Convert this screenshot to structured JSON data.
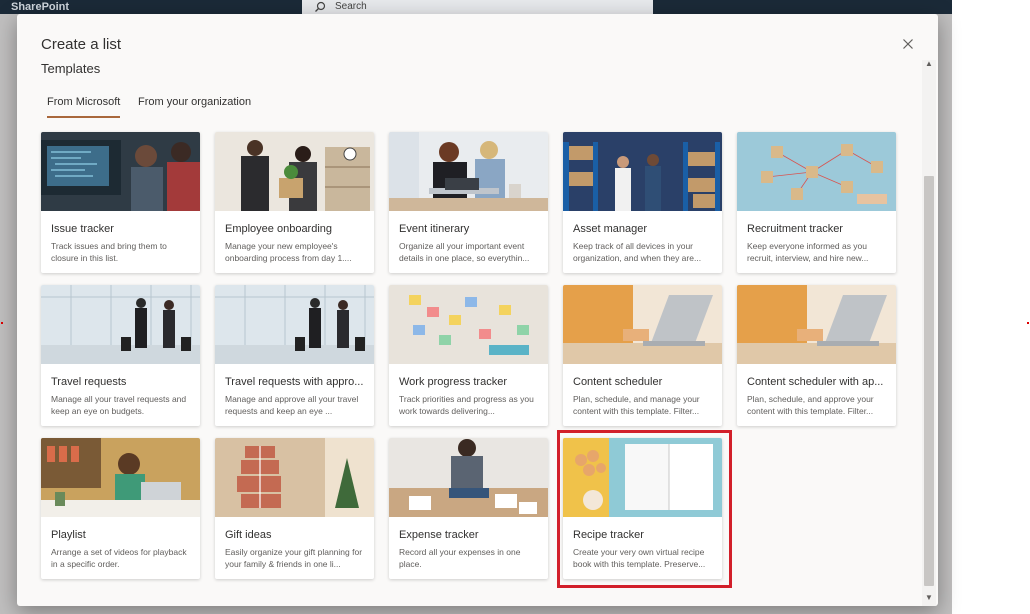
{
  "app": {
    "brand": "SharePoint",
    "search_placeholder": "Search"
  },
  "dialog": {
    "title": "Create a list",
    "section": "Templates",
    "tabs": [
      {
        "label": "From Microsoft",
        "active": true
      },
      {
        "label": "From your organization",
        "active": false
      }
    ]
  },
  "templates": [
    {
      "title": "Issue tracker",
      "description": "Track issues and bring them to closure in this list.",
      "image": "developers-at-monitors"
    },
    {
      "title": "Employee onboarding",
      "description": "Manage your new employee's onboarding process from day 1....",
      "image": "new-employee-handshake"
    },
    {
      "title": "Event itinerary",
      "description": "Organize all your important event details in one place, so everythin...",
      "image": "two-women-at-laptop"
    },
    {
      "title": "Asset manager",
      "description": "Keep track of all devices in your organization, and when they are...",
      "image": "warehouse-workers"
    },
    {
      "title": "Recruitment tracker",
      "description": "Keep everyone informed as you recruit, interview, and hire new...",
      "image": "people-network-cubes"
    },
    {
      "title": "Travel requests",
      "description": "Manage all your travel requests and keep an eye on budgets.",
      "image": "travelers-at-airport"
    },
    {
      "title": "Travel requests with appro...",
      "description": "Manage and approve all your travel requests and keep an eye ...",
      "image": "travelers-at-airport"
    },
    {
      "title": "Work progress tracker",
      "description": "Track priorities and progress as you work towards delivering...",
      "image": "sticky-notes-board"
    },
    {
      "title": "Content scheduler",
      "description": "Plan, schedule, and manage your content with this template. Filter...",
      "image": "laptop-on-desk"
    },
    {
      "title": "Content scheduler with ap...",
      "description": "Plan, schedule, and approve your content with this template. Filter...",
      "image": "laptop-on-desk"
    },
    {
      "title": "Playlist",
      "description": "Arrange a set of videos for playback in a specific order.",
      "image": "woman-with-headphones"
    },
    {
      "title": "Gift ideas",
      "description": "Easily organize your gift planning for your family & friends in one li...",
      "image": "stacked-gifts"
    },
    {
      "title": "Expense tracker",
      "description": "Record all your expenses in one place.",
      "image": "person-with-receipts"
    },
    {
      "title": "Recipe tracker",
      "description": "Create your very own virtual recipe book with this template. Preserve...",
      "image": "eggs-and-notebook",
      "highlighted": true
    }
  ],
  "colors": {
    "dialog_bg": "#faf9f8",
    "tab_underline": "#a9683c",
    "highlight_border": "#d21f2a"
  }
}
